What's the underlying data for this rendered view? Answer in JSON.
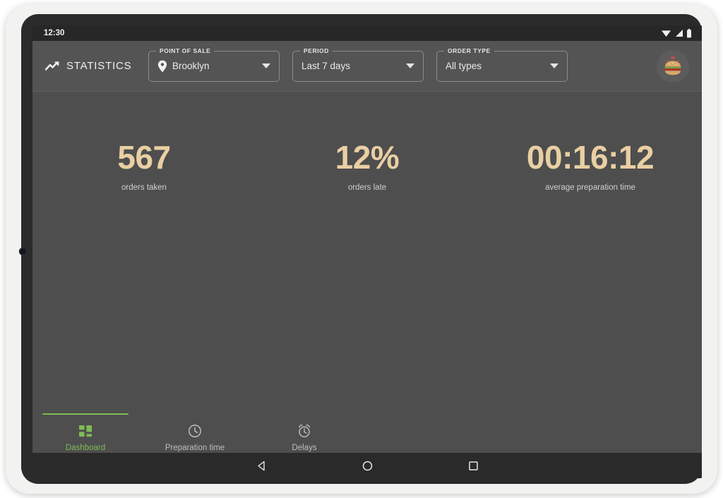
{
  "status_bar": {
    "time": "12:30",
    "icons": [
      "wifi-icon",
      "cellular-signal-icon",
      "battery-icon"
    ]
  },
  "app_bar": {
    "brand_icon": "trending-up-icon",
    "brand_label": "STATISTICS",
    "avatar_icon": "burger-logo-icon",
    "filters": [
      {
        "legend": "POINT OF SALE",
        "value": "Brooklyn",
        "lead_icon": "location-pin-icon",
        "caret_icon": "chevron-down-icon"
      },
      {
        "legend": "PERIOD",
        "value": "Last 7 days",
        "lead_icon": "",
        "caret_icon": "chevron-down-icon"
      },
      {
        "legend": "ORDER TYPE",
        "value": "All types",
        "lead_icon": "",
        "caret_icon": "chevron-down-icon"
      }
    ]
  },
  "main": {
    "kpis": [
      {
        "value": "567",
        "label": "orders taken"
      },
      {
        "value": "12%",
        "label": "orders late"
      },
      {
        "value": "00:16:12",
        "label": "average preparation time"
      }
    ]
  },
  "bottom_nav": {
    "items": [
      {
        "label": "Dashboard",
        "icon": "dashboard-grid-icon",
        "active": true
      },
      {
        "label": "Preparation time",
        "icon": "clock-icon",
        "active": false
      },
      {
        "label": "Delays",
        "icon": "alarm-clock-icon",
        "active": false
      }
    ]
  },
  "android_nav": {
    "back": "back-triangle-icon",
    "home": "home-circle-icon",
    "recents": "recents-square-icon"
  },
  "colors": {
    "accent_green": "#7ebb54",
    "kpi_gold": "#e9cfa3",
    "screen_bg": "#4e4e4e",
    "app_bar_bg": "#545454",
    "status_bar_bg": "#272727"
  }
}
